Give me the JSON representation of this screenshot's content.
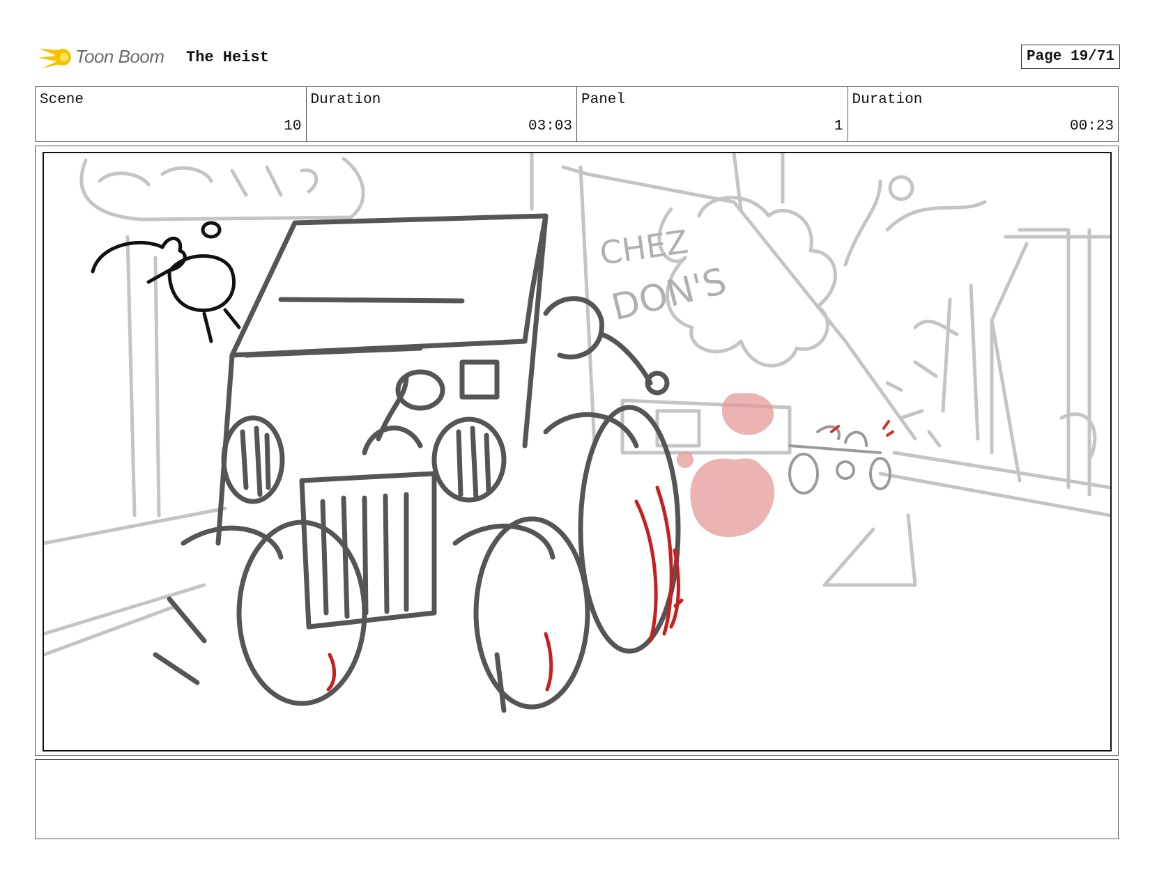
{
  "header": {
    "logo_name": "Toon Boom",
    "title": "The Heist",
    "page": "Page 19/71"
  },
  "info": [
    {
      "label": "Scene",
      "value": "10"
    },
    {
      "label": "Duration",
      "value": "03:03"
    },
    {
      "label": "Panel",
      "value": "1"
    },
    {
      "label": "Duration",
      "value": "00:23"
    }
  ],
  "panel": {
    "sign_text_1": "CHEZ",
    "sign_text_2": "DON'S",
    "accent_color": "#c81e1e",
    "smoke_color": "#e08a8a"
  },
  "notes": {
    "text": ""
  }
}
